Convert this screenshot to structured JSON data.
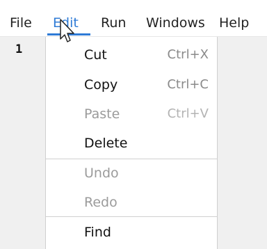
{
  "menubar": {
    "items": [
      {
        "label": "File"
      },
      {
        "label": "Edit"
      },
      {
        "label": "Run"
      },
      {
        "label": "Windows"
      },
      {
        "label": "Help"
      }
    ],
    "active": "Edit"
  },
  "editor": {
    "line_number": "1"
  },
  "edit_menu": {
    "items": [
      {
        "label": "Cut",
        "shortcut": "Ctrl+X",
        "enabled": true
      },
      {
        "label": "Copy",
        "shortcut": "Ctrl+C",
        "enabled": true
      },
      {
        "label": "Paste",
        "shortcut": "Ctrl+V",
        "enabled": false
      },
      {
        "label": "Delete",
        "shortcut": "",
        "enabled": true
      },
      {
        "label": "Undo",
        "shortcut": "",
        "enabled": false
      },
      {
        "label": "Redo",
        "shortcut": "",
        "enabled": false
      },
      {
        "label": "Find",
        "shortcut": "",
        "enabled": true
      }
    ]
  },
  "colors": {
    "accent": "#2f7bd6",
    "editor_background": "#f0f0f0",
    "disabled_text": "#9b9b9b"
  },
  "icons": {
    "pointer": "mouse-pointer-icon"
  }
}
